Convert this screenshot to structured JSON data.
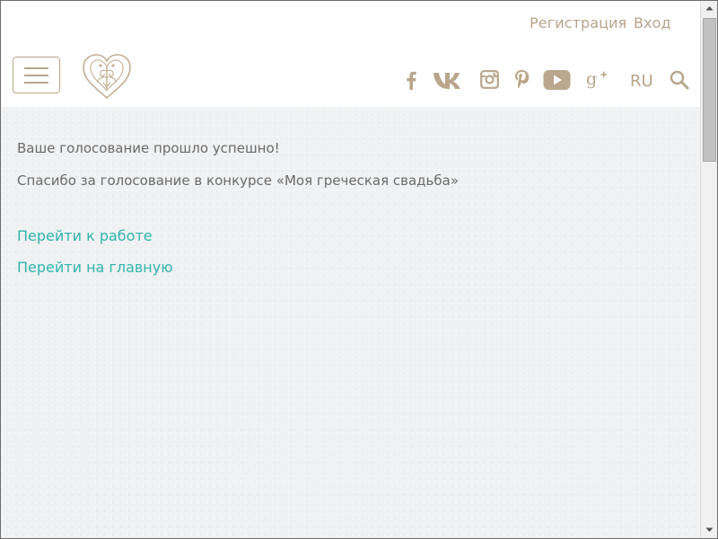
{
  "header": {
    "register_label": "Регистрация",
    "login_label": "Вход",
    "language": "RU",
    "social_icons": [
      "facebook-icon",
      "vk-icon",
      "instagram-icon",
      "pinterest-icon",
      "youtube-icon",
      "google-plus-icon"
    ]
  },
  "content": {
    "message_success": "Ваше голосование прошло успешно!",
    "message_thanks": "Спасибо за голосование в конкурсе «Моя греческая свадьба»",
    "link_to_work": "Перейти к работе",
    "link_to_home": "Перейти на главную"
  },
  "colors": {
    "brand_beige": "#b8a48a",
    "link_teal": "#2fb4ad",
    "text_gray": "#6b6b6b",
    "content_bg": "#f0f1f2"
  }
}
